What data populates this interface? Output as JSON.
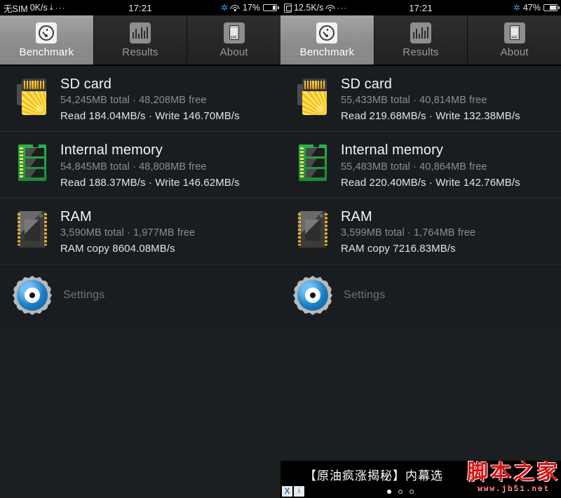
{
  "panels": [
    {
      "status": {
        "carrier": "无SIM",
        "netspeed": "0K/s",
        "download_icon": "download-icon",
        "more": "···",
        "time": "17:21",
        "bluetooth_icon": "bluetooth-icon",
        "wifi_icon": "wifi-icon",
        "battery": "17%",
        "battery_level": 17
      },
      "tabs": [
        {
          "label": "Benchmark",
          "icon": "speedometer-icon",
          "active": true
        },
        {
          "label": "Results",
          "icon": "bar-chart-icon",
          "active": false
        },
        {
          "label": "About",
          "icon": "phone-icon",
          "active": false
        }
      ],
      "items": [
        {
          "title": "SD card",
          "capacity": "54,245MB total · 48,208MB free",
          "speed": "Read 184.04MB/s · Write 146.70MB/s",
          "icon": "sd-card-icon"
        },
        {
          "title": "Internal memory",
          "capacity": "54,845MB total · 48,808MB free",
          "speed": "Read 188.37MB/s · Write 146.62MB/s",
          "icon": "memory-stick-icon"
        },
        {
          "title": "RAM",
          "capacity": "3,590MB total · 1,977MB free",
          "speed": "RAM copy 8604.08MB/s",
          "icon": "ram-chip-icon"
        }
      ],
      "settings": {
        "label": "Settings",
        "icon": "gear-eye-icon"
      }
    },
    {
      "status": {
        "sim_icon": "sim-card-icon",
        "netspeed": "12.5K/s",
        "wifi_icon": "wifi-icon",
        "more": "···",
        "time": "17:21",
        "bluetooth_icon": "bluetooth-icon",
        "battery": "47%",
        "battery_level": 47
      },
      "tabs": [
        {
          "label": "Benchmark",
          "icon": "speedometer-icon",
          "active": true
        },
        {
          "label": "Results",
          "icon": "bar-chart-icon",
          "active": false
        },
        {
          "label": "About",
          "icon": "phone-icon",
          "active": false
        }
      ],
      "items": [
        {
          "title": "SD card",
          "capacity": "55,433MB total  ·  40,814MB free",
          "speed": "Read 219.68MB/s  ·  Write 132.38MB/s",
          "icon": "sd-card-icon"
        },
        {
          "title": "Internal memory",
          "capacity": "55,483MB total  ·  40,864MB free",
          "speed": "Read 220.40MB/s  ·  Write 142.76MB/s",
          "icon": "memory-stick-icon"
        },
        {
          "title": "RAM",
          "capacity": "3,599MB total  ·  1,764MB free",
          "speed": "RAM copy 7216.83MB/s",
          "icon": "ram-chip-icon"
        }
      ],
      "settings": {
        "label": "Settings",
        "icon": "gear-eye-icon"
      }
    }
  ],
  "ad": {
    "text": "【原油疯涨揭秘】内幕选",
    "close": "X",
    "info": "i",
    "dots_total": 3,
    "dots_active_index": 0
  },
  "watermark": {
    "cn": "脚本之家",
    "url": "www.jb51.net"
  },
  "colors": {
    "accent_yellow": "#f7c200",
    "accent_green": "#2bb14a",
    "accent_blue": "#1a7fc6",
    "bg_dark": "#1a1d1f",
    "watermark_red": "#d81414"
  }
}
